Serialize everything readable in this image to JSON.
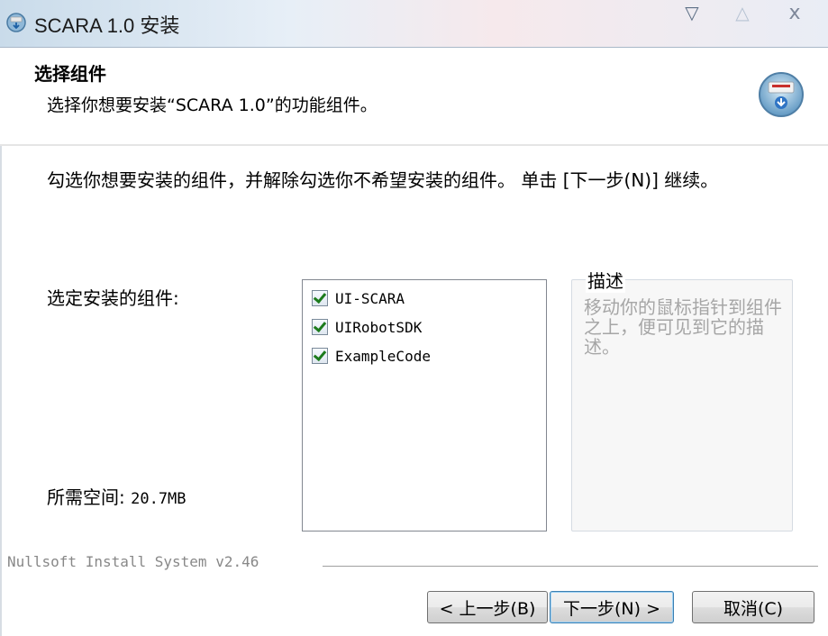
{
  "window": {
    "title": "SCARA 1.0 安装",
    "min_glyph": "▽",
    "max_glyph": "△",
    "close_glyph": "ⅹ"
  },
  "header": {
    "title": "选择组件",
    "subtitle": "选择你想要安装“SCARA 1.0”的功能组件。"
  },
  "instructions": "勾选你想要安装的组件，并解除勾选你不希望安装的组件。 单击 [下一步(N)] 继续。",
  "components": {
    "label": "选定安装的组件:",
    "items": [
      {
        "label": "UI-SCARA",
        "checked": true
      },
      {
        "label": "UIRobotSDK",
        "checked": true
      },
      {
        "label": "ExampleCode",
        "checked": true
      }
    ]
  },
  "space": {
    "label": "所需空间:",
    "value": "20.7MB"
  },
  "description": {
    "legend": "描述",
    "text": "移动你的鼠标指针到组件之上，便可见到它的描述。"
  },
  "footer": {
    "brand": "Nullsoft Install System v2.46"
  },
  "buttons": {
    "back": "< 上一步(B)",
    "next": "下一步(N) >",
    "cancel": "取消(C)"
  },
  "colors": {
    "accent": "#3c7fb1",
    "check": "#1c7b1c",
    "description_text": "#a6a6a6"
  }
}
